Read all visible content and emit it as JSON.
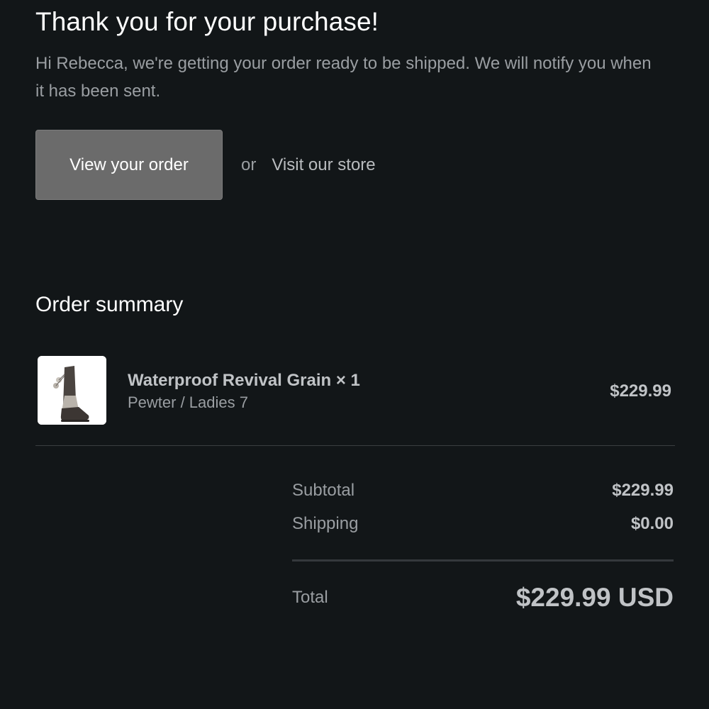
{
  "header": {
    "title": "Thank you for your purchase!",
    "message": "Hi Rebecca, we're getting your order ready to be shipped. We will notify you when it has been sent."
  },
  "actions": {
    "view_order_label": "View your order",
    "or_text": "or",
    "visit_store_label": "Visit our store"
  },
  "order_summary": {
    "title": "Order summary",
    "items": [
      {
        "name": "Waterproof Revival Grain × 1",
        "variant": "Pewter / Ladies 7",
        "price": "$229.99",
        "image_icon": "boot-product-image"
      }
    ],
    "subtotal_label": "Subtotal",
    "subtotal_value": "$229.99",
    "shipping_label": "Shipping",
    "shipping_value": "$0.00",
    "total_label": "Total",
    "total_value": "$229.99 USD"
  },
  "colors": {
    "background": "#121618",
    "button": "#6b6b6b",
    "text_primary": "#ffffff",
    "text_muted": "#9a9ea2"
  }
}
